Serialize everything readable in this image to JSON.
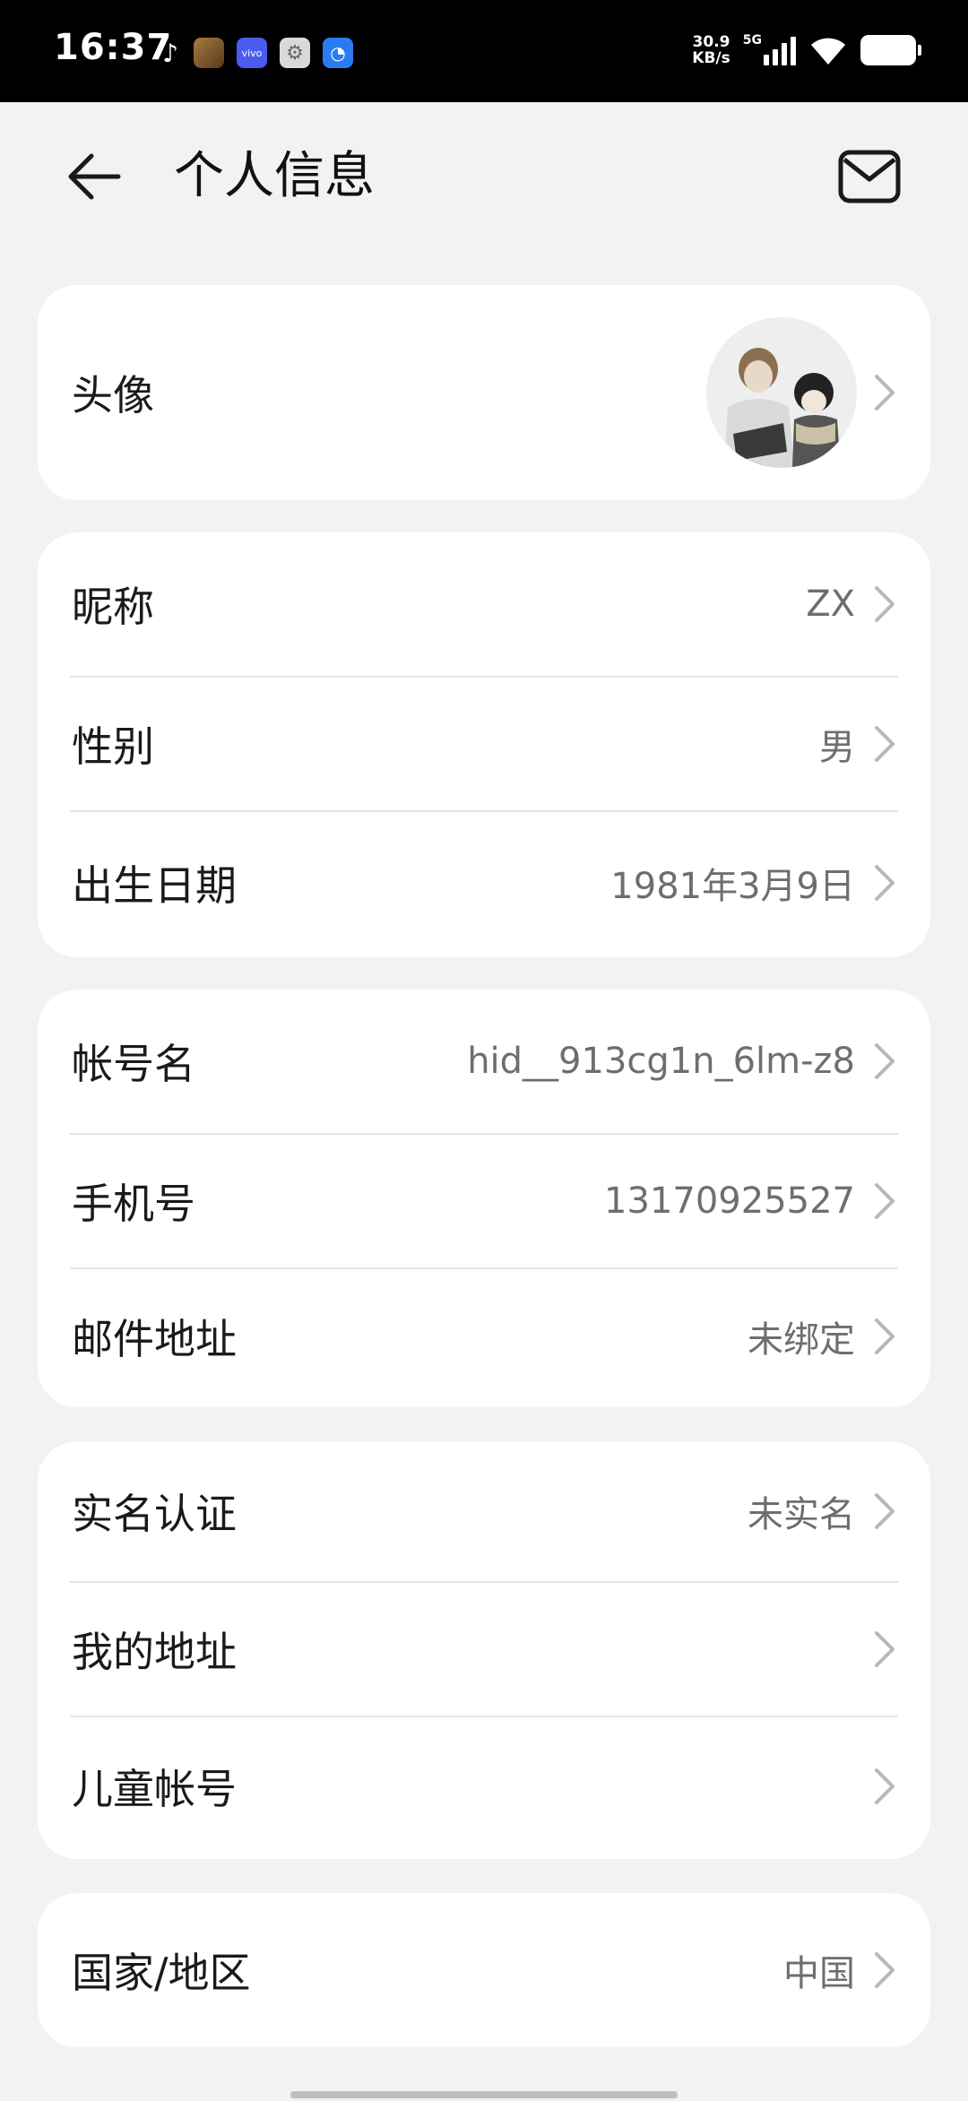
{
  "status_bar": {
    "time": "16:37",
    "net_speed_value": "30.9",
    "net_speed_unit": "KB/s",
    "network_type": "5G",
    "app_icons": [
      "tiktok-icon",
      "game-icon",
      "vivo-icon",
      "settings-icon",
      "browser-icon"
    ]
  },
  "header": {
    "title": "个人信息",
    "back_icon": "arrow-left-icon",
    "mail_icon": "mail-icon"
  },
  "sections": {
    "avatar": {
      "label": "头像"
    },
    "profile": {
      "nickname": {
        "label": "昵称",
        "value": "ZX"
      },
      "gender": {
        "label": "性别",
        "value": "男"
      },
      "birthday": {
        "label": "出生日期",
        "value": "1981年3月9日"
      }
    },
    "account": {
      "account_name": {
        "label": "帐号名",
        "value": "hid__913cg1n_6lm-z8"
      },
      "phone": {
        "label": "手机号",
        "value": "13170925527"
      },
      "email": {
        "label": "邮件地址",
        "value": "未绑定"
      }
    },
    "other": {
      "real_name": {
        "label": "实名认证",
        "value": "未实名"
      },
      "my_address": {
        "label": "我的地址"
      },
      "child_account": {
        "label": "儿童帐号"
      }
    },
    "region": {
      "country": {
        "label": "国家/地区",
        "value": "中国"
      }
    }
  },
  "colors": {
    "page_bg": "#f1f2f4",
    "card_bg": "#ffffff",
    "label_text": "#1a1a1a",
    "value_text": "#6e6e6e",
    "chevron": "#b8b8b8"
  }
}
